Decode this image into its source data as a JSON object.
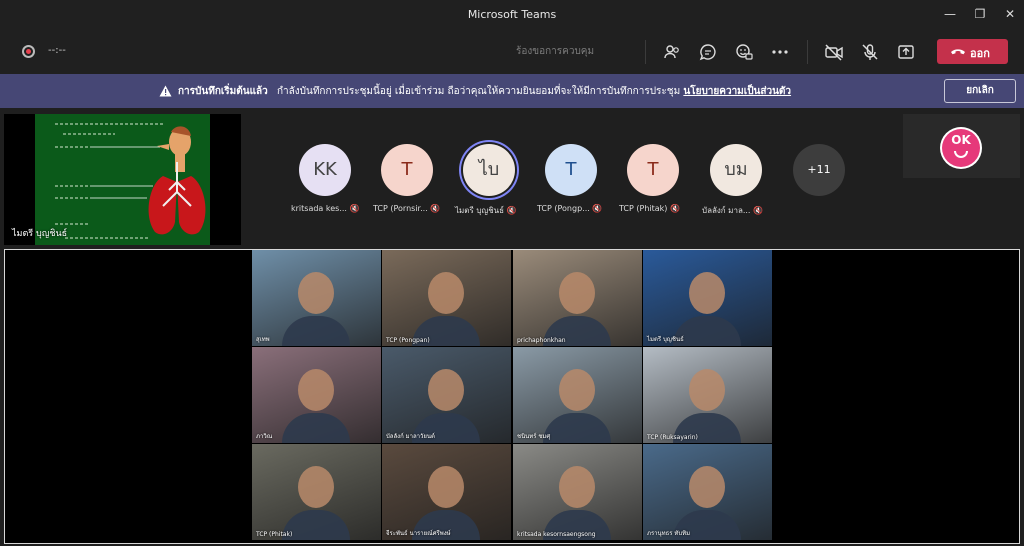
{
  "window": {
    "title": "Microsoft Teams"
  },
  "toolbar": {
    "timer": "--:--",
    "request_control": "ร้องขอการควบคุม",
    "leave_label": "ออก",
    "icons": [
      "people-icon",
      "chat-icon",
      "reactions-icon",
      "more-icon",
      "camera-off-icon",
      "mic-off-icon",
      "share-tray-icon",
      "phone-icon"
    ]
  },
  "banner": {
    "title": "การบันทึกเริ่มต้นแล้ว",
    "message": "กำลังบันทึกการประชุมนี้อยู่ เมื่อเข้าร่วม ถือว่าคุณให้ความยินยอมที่จะให้มีการบันทึกการประชุม",
    "link": "นโยบายความเป็นส่วนตัว",
    "cancel_label": "ยกเลิก"
  },
  "share": {
    "presenter": "ไมตรี บุญชินธ์"
  },
  "participants": [
    {
      "initials": "KK",
      "name": "kritsada kes...",
      "bg": "#e6e0f3",
      "fg": "#444"
    },
    {
      "initials": "T",
      "name": "TCP (Pornsir...",
      "bg": "#f6d5cc",
      "fg": "#8a2a1a"
    },
    {
      "initials": "ไบ",
      "name": "ไมตรี บุญชินธ์",
      "bg": "#f1e8e0",
      "fg": "#444"
    },
    {
      "initials": "T",
      "name": "TCP (Pongp...",
      "bg": "#cfe0f6",
      "fg": "#1f4f8f"
    },
    {
      "initials": "T",
      "name": "TCP (Phitak)",
      "bg": "#f6d5cc",
      "fg": "#8a2a1a"
    },
    {
      "initials": "บม",
      "name": "บัลลังก์ มาล...",
      "bg": "#f1e8e0",
      "fg": "#444"
    },
    {
      "initials": "+11",
      "name": "",
      "bg": "#3d3d3d",
      "fg": "#fff"
    }
  ],
  "ok_badge": {
    "text": "OK"
  },
  "videos": [
    {
      "name": "สุเทพ",
      "color": "#6f8fa8"
    },
    {
      "name": "TCP (Pongpan)",
      "color": "#7a6a5a"
    },
    {
      "name": "prichaphonkhan",
      "color": "#9a8b7a"
    },
    {
      "name": "ไมตรี บุญชินธ์",
      "color": "#2a5a9a"
    },
    {
      "name": "ภาวิณ",
      "color": "#8a6f7a"
    },
    {
      "name": "บัลลังก์ มาลาวัยนต์",
      "color": "#4a5a6a"
    },
    {
      "name": "ชนินทร์ ชมศุ",
      "color": "#8a9aa6"
    },
    {
      "name": "TCP (Ruksayarin)",
      "color": "#b4bcc4"
    },
    {
      "name": "TCP (Phitak)",
      "color": "#6a6a60"
    },
    {
      "name": "จีระพันธ์ นารายณ์ศรีพงษ์",
      "color": "#5a4a3e"
    },
    {
      "name": "kritsada kesornsaengsong",
      "color": "#8a8a86"
    },
    {
      "name": "ภรานุทธร ทับทิม",
      "color": "#4a6a8a"
    }
  ]
}
